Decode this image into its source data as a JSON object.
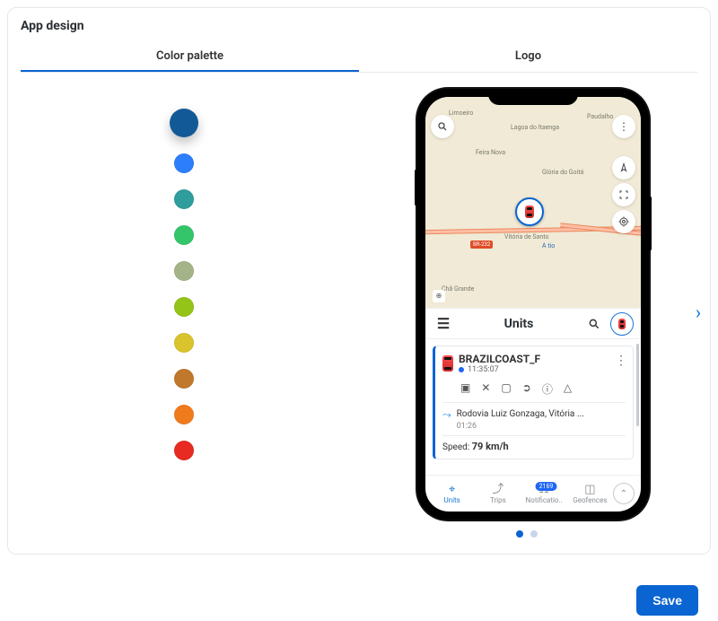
{
  "page_title": "App design",
  "tabs": {
    "palette": "Color palette",
    "logo": "Logo"
  },
  "colors": {
    "selected_index": 0,
    "swatches": [
      "#125a97",
      "#2d7efc",
      "#2f9d9b",
      "#34c56a",
      "#a5b389",
      "#94c417",
      "#d9c42e",
      "#c0782d",
      "#f07b1d",
      "#e72a22"
    ]
  },
  "buttons": {
    "save": "Save"
  },
  "preview": {
    "map": {
      "labels": {
        "limoeiro": "Limoeiro",
        "lagoa": "Lagoa do Itaenga",
        "feira": "Feira Nova",
        "gloria": "Glória do Goitá",
        "vitoria": "Vitória de Santo",
        "cha": "Chã Grande",
        "paudalho": "Paudalho",
        "atio": "A tio"
      },
      "road_tag": "BR-232"
    },
    "units_header": "Units",
    "unit_card": {
      "name": "BRAZILCOAST_F",
      "time": "11:35:07",
      "route_text": "Rodovia Luiz Gonzaga, Vitória ...",
      "route_time": "01:26",
      "speed_label": "Speed:",
      "speed_value": "79 km/h"
    },
    "bottom_nav": {
      "units": "Units",
      "trips": "Trips",
      "notifications": "Notificatio..",
      "geofences": "Geofences",
      "badge": "2169"
    }
  }
}
